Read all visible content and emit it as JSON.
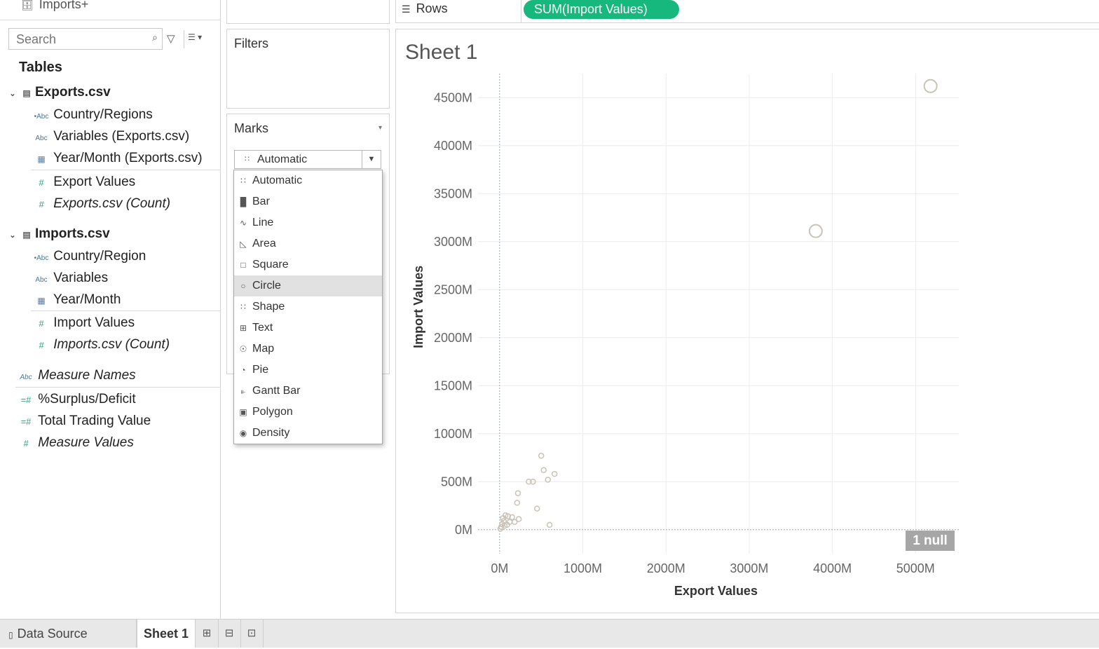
{
  "datasource": {
    "title": "Imports+"
  },
  "search": {
    "placeholder": "Search"
  },
  "tables_heading": "Tables",
  "tables": [
    {
      "name": "Exports.csv",
      "fields": [
        {
          "label": "Country/Regions",
          "icon": "geo-abc-icon"
        },
        {
          "label": "Variables (Exports.csv)",
          "icon": "abc-icon"
        },
        {
          "label": "Year/Month (Exports.csv)",
          "icon": "calendar-icon"
        },
        {
          "label": "Export Values",
          "icon": "number-icon"
        },
        {
          "label": "Exports.csv (Count)",
          "icon": "number-icon"
        }
      ]
    },
    {
      "name": "Imports.csv",
      "fields": [
        {
          "label": "Country/Region",
          "icon": "geo-abc-icon"
        },
        {
          "label": "Variables",
          "icon": "abc-icon"
        },
        {
          "label": "Year/Month",
          "icon": "calendar-icon"
        },
        {
          "label": "Import Values",
          "icon": "number-icon"
        },
        {
          "label": "Imports.csv (Count)",
          "icon": "number-icon"
        }
      ]
    }
  ],
  "extra_fields": [
    "Measure Names",
    "%Surplus/Deficit",
    "Total Trading Value",
    "Measure Values"
  ],
  "shelves": {
    "filters": "Filters",
    "marks": "Marks",
    "rows": "Rows",
    "rows_pill": "SUM(Import Values)"
  },
  "mark_type": {
    "selected": "Automatic"
  },
  "mark_menu": [
    "Automatic",
    "Bar",
    "Line",
    "Area",
    "Square",
    "Circle",
    "Shape",
    "Text",
    "Map",
    "Pie",
    "Gantt Bar",
    "Polygon",
    "Density"
  ],
  "mark_menu_highlighted": "Circle",
  "sheet": {
    "title": "Sheet 1",
    "null_badge": "1 null"
  },
  "tabs": {
    "data_source": "Data Source",
    "sheet": "Sheet 1"
  },
  "colors": {
    "pill": "#16b87e",
    "mark": "#c9c3b6",
    "null_badge": "#a6a6a6"
  },
  "chart_data": {
    "type": "scatter",
    "title": "",
    "xlabel": "Export Values",
    "ylabel": "Import Values",
    "xlim": [
      -260,
      5520
    ],
    "ylim": [
      -250,
      4750
    ],
    "x_ticks": [
      "0M",
      "1000M",
      "2000M",
      "3000M",
      "4000M",
      "5000M"
    ],
    "x_tick_values": [
      0,
      1000,
      2000,
      3000,
      4000,
      5000
    ],
    "y_ticks": [
      "0M",
      "500M",
      "1000M",
      "1500M",
      "2000M",
      "2500M",
      "3000M",
      "3500M",
      "4000M",
      "4500M"
    ],
    "y_tick_values": [
      0,
      500,
      1000,
      1500,
      2000,
      2500,
      3000,
      3500,
      4000,
      4500
    ],
    "grid": true,
    "series": [
      {
        "x": [
          5180,
          3800,
          500,
          530,
          660,
          580,
          350,
          400,
          220,
          210,
          450,
          600,
          150,
          230,
          180,
          100,
          70,
          40,
          50,
          30,
          60,
          20,
          10,
          120,
          90
        ],
        "y": [
          4620,
          3110,
          770,
          620,
          580,
          520,
          500,
          500,
          380,
          280,
          220,
          50,
          130,
          110,
          80,
          140,
          150,
          120,
          90,
          60,
          40,
          30,
          10,
          80,
          50
        ]
      }
    ]
  }
}
